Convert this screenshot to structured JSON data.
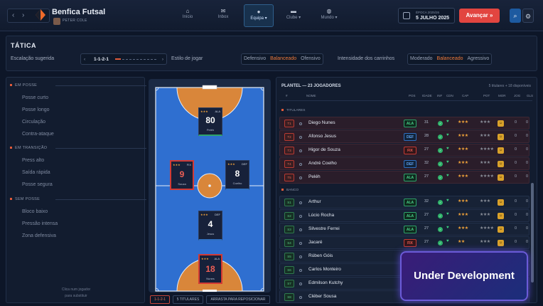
{
  "header": {
    "club_name": "Benfica Futsal",
    "manager_name": "PETER COLE",
    "date_label": "ÉPOCA 2025/26",
    "date_value": "5 JULHO 2025",
    "advance_label": "Avançar »"
  },
  "nav": [
    {
      "label": "Início",
      "icon": "home-icon"
    },
    {
      "label": "Inbox",
      "icon": "mail-icon"
    },
    {
      "label": "Equipa ▾",
      "icon": "ball-icon"
    },
    {
      "label": "Clube ▾",
      "icon": "stadium-icon"
    },
    {
      "label": "Mundo ▾",
      "icon": "globe-icon"
    }
  ],
  "tactics": {
    "title": "TÁTICA",
    "formation_label": "Escalação sugerida",
    "formation_value": "1-1-2-1",
    "style_label": "Estilo de jogar",
    "style_options": [
      "Defensivo",
      "Balanceado",
      "Ofensivo"
    ],
    "style_selected": "Balanceado",
    "tackle_label": "Intensidade dos carrinhos",
    "tackle_options": [
      "Moderado",
      "Balanceado",
      "Agressivo"
    ],
    "tackle_selected": "Balanceado"
  },
  "left_panel": {
    "sections": [
      {
        "title": "EM POSSE",
        "items": [
          "Posse curto",
          "Posse longo",
          "Circulação",
          "Contra-ataque"
        ]
      },
      {
        "title": "EM TRANSIÇÃO",
        "items": [
          "Press alto",
          "Saída rápida",
          "Posse segura"
        ]
      },
      {
        "title": "SEM POSSE",
        "items": [
          "Bloco baixo",
          "Pressão intensa",
          "Zona defensiva"
        ]
      }
    ],
    "hint": [
      "Clica num jogador",
      "para substituir"
    ]
  },
  "pitch": {
    "cards": [
      {
        "number": "80",
        "name": "Peléh",
        "pos": "ALA",
        "rating": "★★★"
      },
      {
        "number": "9",
        "name": "Souza",
        "pos": "FIX",
        "rating": "★★★"
      },
      {
        "number": "8",
        "name": "Coelho",
        "pos": "DEF",
        "rating": "★★★"
      },
      {
        "number": "4",
        "name": "Jesus",
        "pos": "DEF",
        "rating": "★★★"
      },
      {
        "number": "18",
        "name": "Nunes",
        "pos": "ALA",
        "rating": "★★★"
      }
    ],
    "buttons": [
      "1-1-2-1",
      "5 TITULARES",
      "ARRASTA PARA REPOSICIONAR"
    ]
  },
  "squad": {
    "title": "PLANTEL — 23 JOGADORES",
    "summary": "5 titulares + 18 disponíveis",
    "columns": [
      "#",
      "NOME",
      "POS",
      "IDADE",
      "INF",
      "CDN",
      "CAP",
      "POT",
      "MOR",
      "JOG",
      "GLS"
    ],
    "groups": [
      "TITULARES",
      "BANCO"
    ],
    "starters": [
      {
        "num": "T1",
        "name": "Diego Nunes",
        "pos": "ALA",
        "age": "31",
        "cap": "★★★",
        "pot": "★★★",
        "jog": "0",
        "gls": "0"
      },
      {
        "num": "T2",
        "name": "Afonso Jesus",
        "pos": "DEF",
        "age": "28",
        "cap": "★★★",
        "pot": "★★★",
        "jog": "0",
        "gls": "0"
      },
      {
        "num": "T3",
        "name": "Higor de Souza",
        "pos": "FIX",
        "age": "27",
        "cap": "★★★",
        "pot": "★★★★",
        "jog": "0",
        "gls": "0"
      },
      {
        "num": "T4",
        "name": "André Coelho",
        "pos": "DEF",
        "age": "32",
        "cap": "★★★",
        "pot": "★★★",
        "jog": "0",
        "gls": "0"
      },
      {
        "num": "T5",
        "name": "Peléh",
        "pos": "ALA",
        "age": "27",
        "cap": "★★★",
        "pot": "★★★★",
        "jog": "0",
        "gls": "0"
      }
    ],
    "bench": [
      {
        "num": "S1",
        "name": "Arthur",
        "pos": "ALA",
        "age": "32",
        "cap": "★★★",
        "pot": "★★★",
        "jog": "0",
        "gls": "0"
      },
      {
        "num": "S2",
        "name": "Lúcio Rocha",
        "pos": "ALA",
        "age": "27",
        "cap": "★★★",
        "pot": "★★★",
        "jog": "0",
        "gls": "0"
      },
      {
        "num": "S3",
        "name": "Silvestre Ferrei",
        "pos": "ALA",
        "age": "27",
        "cap": "★★★",
        "pot": "★★★★",
        "jog": "0",
        "gls": "0"
      },
      {
        "num": "S4",
        "name": "Jacaré",
        "pos": "FIX",
        "age": "27",
        "cap": "★★",
        "pot": "★★★",
        "jog": "0",
        "gls": "0"
      },
      {
        "num": "S5",
        "name": "Rúben Góis",
        "pos": "",
        "age": "",
        "cap": "",
        "pot": "",
        "jog": "",
        "gls": ""
      },
      {
        "num": "S6",
        "name": "Carlos Monteiro",
        "pos": "",
        "age": "",
        "cap": "",
        "pot": "",
        "jog": "",
        "gls": ""
      },
      {
        "num": "S7",
        "name": "Edmilson Kutchy",
        "pos": "",
        "age": "",
        "cap": "",
        "pot": "",
        "jog": "",
        "gls": ""
      },
      {
        "num": "S8",
        "name": "Cléber Sousa",
        "pos": "",
        "age": "",
        "cap": "",
        "pot": "",
        "jog": "",
        "gls": ""
      }
    ]
  },
  "overlay": {
    "label": "Under Development"
  },
  "colors": {
    "accent": "#e24540",
    "pitch": "#2f6fd0",
    "circle": "#d9863a"
  }
}
